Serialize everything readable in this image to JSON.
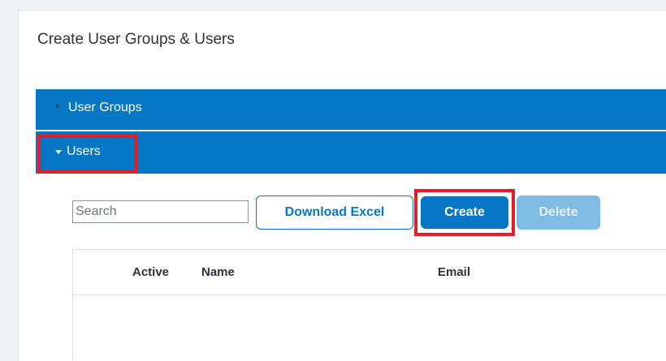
{
  "page": {
    "title": "Create User Groups & Users"
  },
  "sections": {
    "user_groups": {
      "label": "User Groups",
      "state": "collapsed",
      "icon": "caret-right-icon"
    },
    "users": {
      "label": "Users",
      "state": "expanded",
      "icon": "caret-down-icon"
    }
  },
  "toolbar": {
    "search_placeholder": "Search",
    "search_value": "",
    "download_label": "Download Excel",
    "create_label": "Create",
    "delete_label": "Delete",
    "delete_enabled": false
  },
  "table": {
    "columns": [
      "Active",
      "Name",
      "Email"
    ],
    "rows": []
  },
  "colors": {
    "accent": "#0577c4",
    "highlight": "#e01f26",
    "disabled_button": "#7fbbe3"
  }
}
